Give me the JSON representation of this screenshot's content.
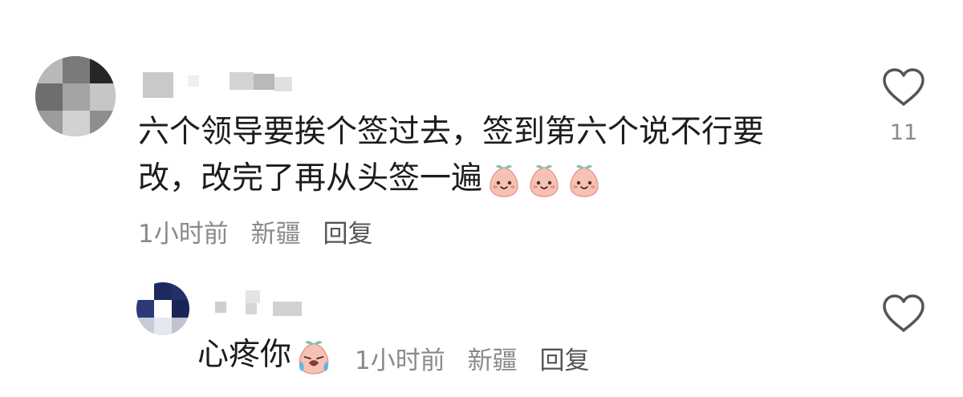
{
  "comments": [
    {
      "text_lines": [
        "六个领导要挨个签过去，签到第六个说不行要",
        "改，改完了再从头签一遍"
      ],
      "emojis": [
        "smiling-peach-icon",
        "smiling-peach-icon",
        "smiling-peach-icon"
      ],
      "time": "1小时前",
      "location": "新疆",
      "reply_label": "回复",
      "like_count": "11",
      "like_icon": "heart-outline-icon"
    }
  ],
  "replies": [
    {
      "text": "心疼你",
      "emoji": "crying-peach-icon",
      "time": "1小时前",
      "location": "新疆",
      "reply_label": "回复",
      "like_count": "",
      "like_icon": "heart-outline-icon"
    }
  ],
  "colors": {
    "text": "#1c1c1c",
    "meta": "#8a8a8a",
    "reply": "#555555",
    "heart_stroke": "#555555",
    "peach": "#f6c2b5",
    "leaf": "#7cc3a5"
  }
}
